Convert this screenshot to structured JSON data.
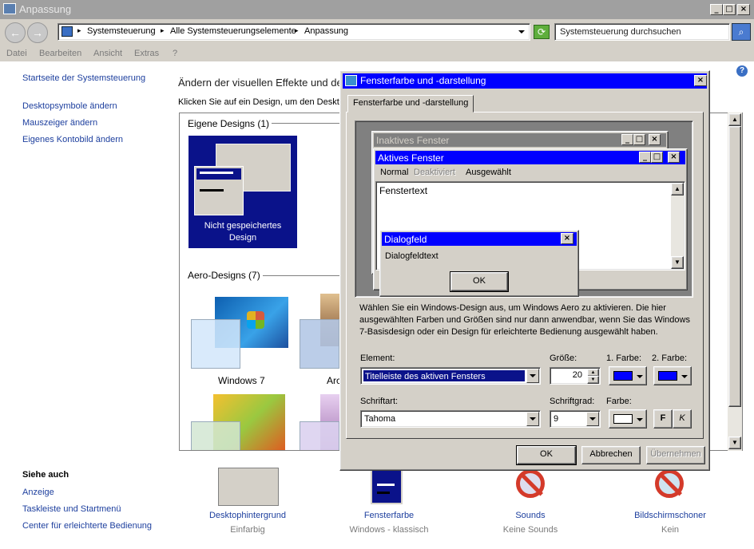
{
  "window": {
    "title": "Anpassung"
  },
  "address": {
    "crumbs": [
      "Systemsteuerung",
      "Alle Systemsteuerungselemente",
      "Anpassung"
    ],
    "search_placeholder": "Systemsteuerung durchsuchen"
  },
  "menu": [
    "Datei",
    "Bearbeiten",
    "Ansicht",
    "Extras",
    "?"
  ],
  "sidebar": {
    "links": [
      "Startseite der Systemsteuerung",
      "Desktopsymbole ändern",
      "Mauszeiger ändern",
      "Eigenes Kontobild ändern"
    ],
    "see_also_title": "Siehe auch",
    "see_also": [
      "Anzeige",
      "Taskleiste und Startmenü",
      "Center für erleichterte Bedienung"
    ]
  },
  "main": {
    "heading": "Ändern der visuellen Effekte und der",
    "subheading": "Klicken Sie auf ein Design, um den Desktop",
    "own_designs_label": "Eigene Designs (1)",
    "unsaved_theme": "Nicht gespeichertes Design",
    "aero_label": "Aero-Designs (7)",
    "win7_label": "Windows 7",
    "arch_label": "Arc"
  },
  "bottom": [
    {
      "title": "Desktophintergrund",
      "sub": "Einfarbig"
    },
    {
      "title": "Fensterfarbe",
      "sub": "Windows - klassisch"
    },
    {
      "title": "Sounds",
      "sub": "Keine Sounds"
    },
    {
      "title": "Bildschirmschoner",
      "sub": "Kein"
    }
  ],
  "dialog": {
    "title": "Fensterfarbe und -darstellung",
    "tab": "Fensterfarbe und -darstellung",
    "preview": {
      "inactive_title": "Inaktives Fenster",
      "active_title": "Aktives Fenster",
      "menu_normal": "Normal",
      "menu_disabled": "Deaktiviert",
      "menu_selected": "Ausgewählt",
      "window_text": "Fenstertext",
      "msgbox_title": "Dialogfeld",
      "msgbox_text": "Dialogfeldtext",
      "ok": "OK"
    },
    "description": "Wählen Sie ein Windows-Design aus, um Windows Aero zu aktivieren. Die hier ausgewählten Farben und Größen sind nur dann anwendbar, wenn Sie das Windows 7-Basisdesign oder ein Design für erleichterte Bedienung ausgewählt haben.",
    "element_label": "Element:",
    "element_value": "Titelleiste des aktiven Fensters",
    "size_label": "Größe:",
    "size_value": "20",
    "color1_label": "1. Farbe:",
    "color2_label": "2. Farbe:",
    "font_label": "Schriftart:",
    "font_value": "Tahoma",
    "fontsize_label": "Schriftgrad:",
    "fontsize_value": "9",
    "color_label": "Farbe:",
    "bold": "F",
    "italic": "K",
    "ok": "OK",
    "cancel": "Abbrechen",
    "apply": "Übernehmen"
  },
  "colors": {
    "title_active": "#0000ff",
    "title_inactive": "#808080",
    "face": "#d4d0c8",
    "link": "#1d3f9e"
  }
}
